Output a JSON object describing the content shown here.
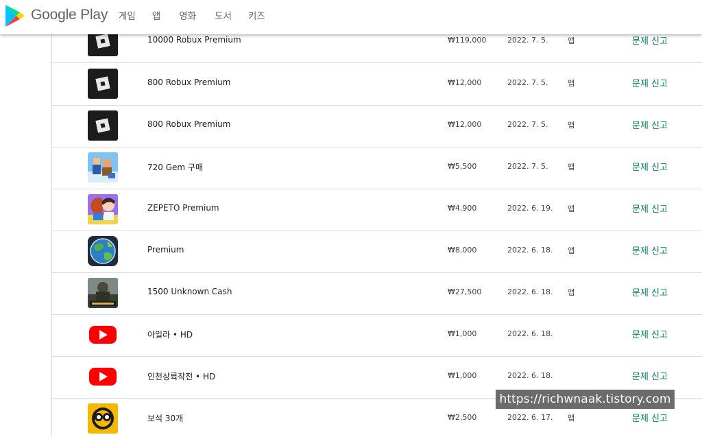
{
  "header": {
    "brand": "Google Play",
    "nav": [
      "게임",
      "앱",
      "영화",
      "도서",
      "키즈"
    ]
  },
  "rows": [
    {
      "icon": "roblox-icon",
      "name": "10000 Robux Premium",
      "price": "₩119,000",
      "date": "2022. 7. 5.",
      "type": "앱",
      "report": "문제 신고"
    },
    {
      "icon": "roblox-icon",
      "name": "800 Robux Premium",
      "price": "₩12,000",
      "date": "2022. 7. 5.",
      "type": "앱",
      "report": "문제 신고"
    },
    {
      "icon": "roblox-icon",
      "name": "800 Robux Premium",
      "price": "₩12,000",
      "date": "2022. 7. 5.",
      "type": "앱",
      "report": "문제 신고"
    },
    {
      "icon": "pixel-game-icon",
      "name": "720 Gem 구매",
      "price": "₩5,500",
      "date": "2022. 7. 5.",
      "type": "앱",
      "report": "문제 신고"
    },
    {
      "icon": "zepeto-icon",
      "name": "ZEPETO Premium",
      "price": "₩4,900",
      "date": "2022. 6. 19.",
      "type": "앱",
      "report": "문제 신고"
    },
    {
      "icon": "globe-icon",
      "name": "Premium",
      "price": "₩8,000",
      "date": "2022. 6. 18.",
      "type": "앱",
      "report": "문제 신고"
    },
    {
      "icon": "pubg-icon",
      "name": "1500 Unknown Cash",
      "price": "₩27,500",
      "date": "2022. 6. 18.",
      "type": "앱",
      "report": "문제 신고"
    },
    {
      "icon": "youtube-icon",
      "name": "아일라 • HD",
      "price": "₩1,000",
      "date": "2022. 6. 18.",
      "type": "",
      "report": "문제 신고"
    },
    {
      "icon": "youtube-icon",
      "name": "인천상륙작전 • HD",
      "price": "₩1,000",
      "date": "2022. 6. 18.",
      "type": "",
      "report": "문제 신고"
    },
    {
      "icon": "brawl-stars-icon",
      "name": "보석 30개",
      "price": "₩2,500",
      "date": "2022. 6. 17.",
      "type": "앱",
      "report": "문제 신고"
    }
  ],
  "watermark": "https://richwnaak.tistory.com"
}
